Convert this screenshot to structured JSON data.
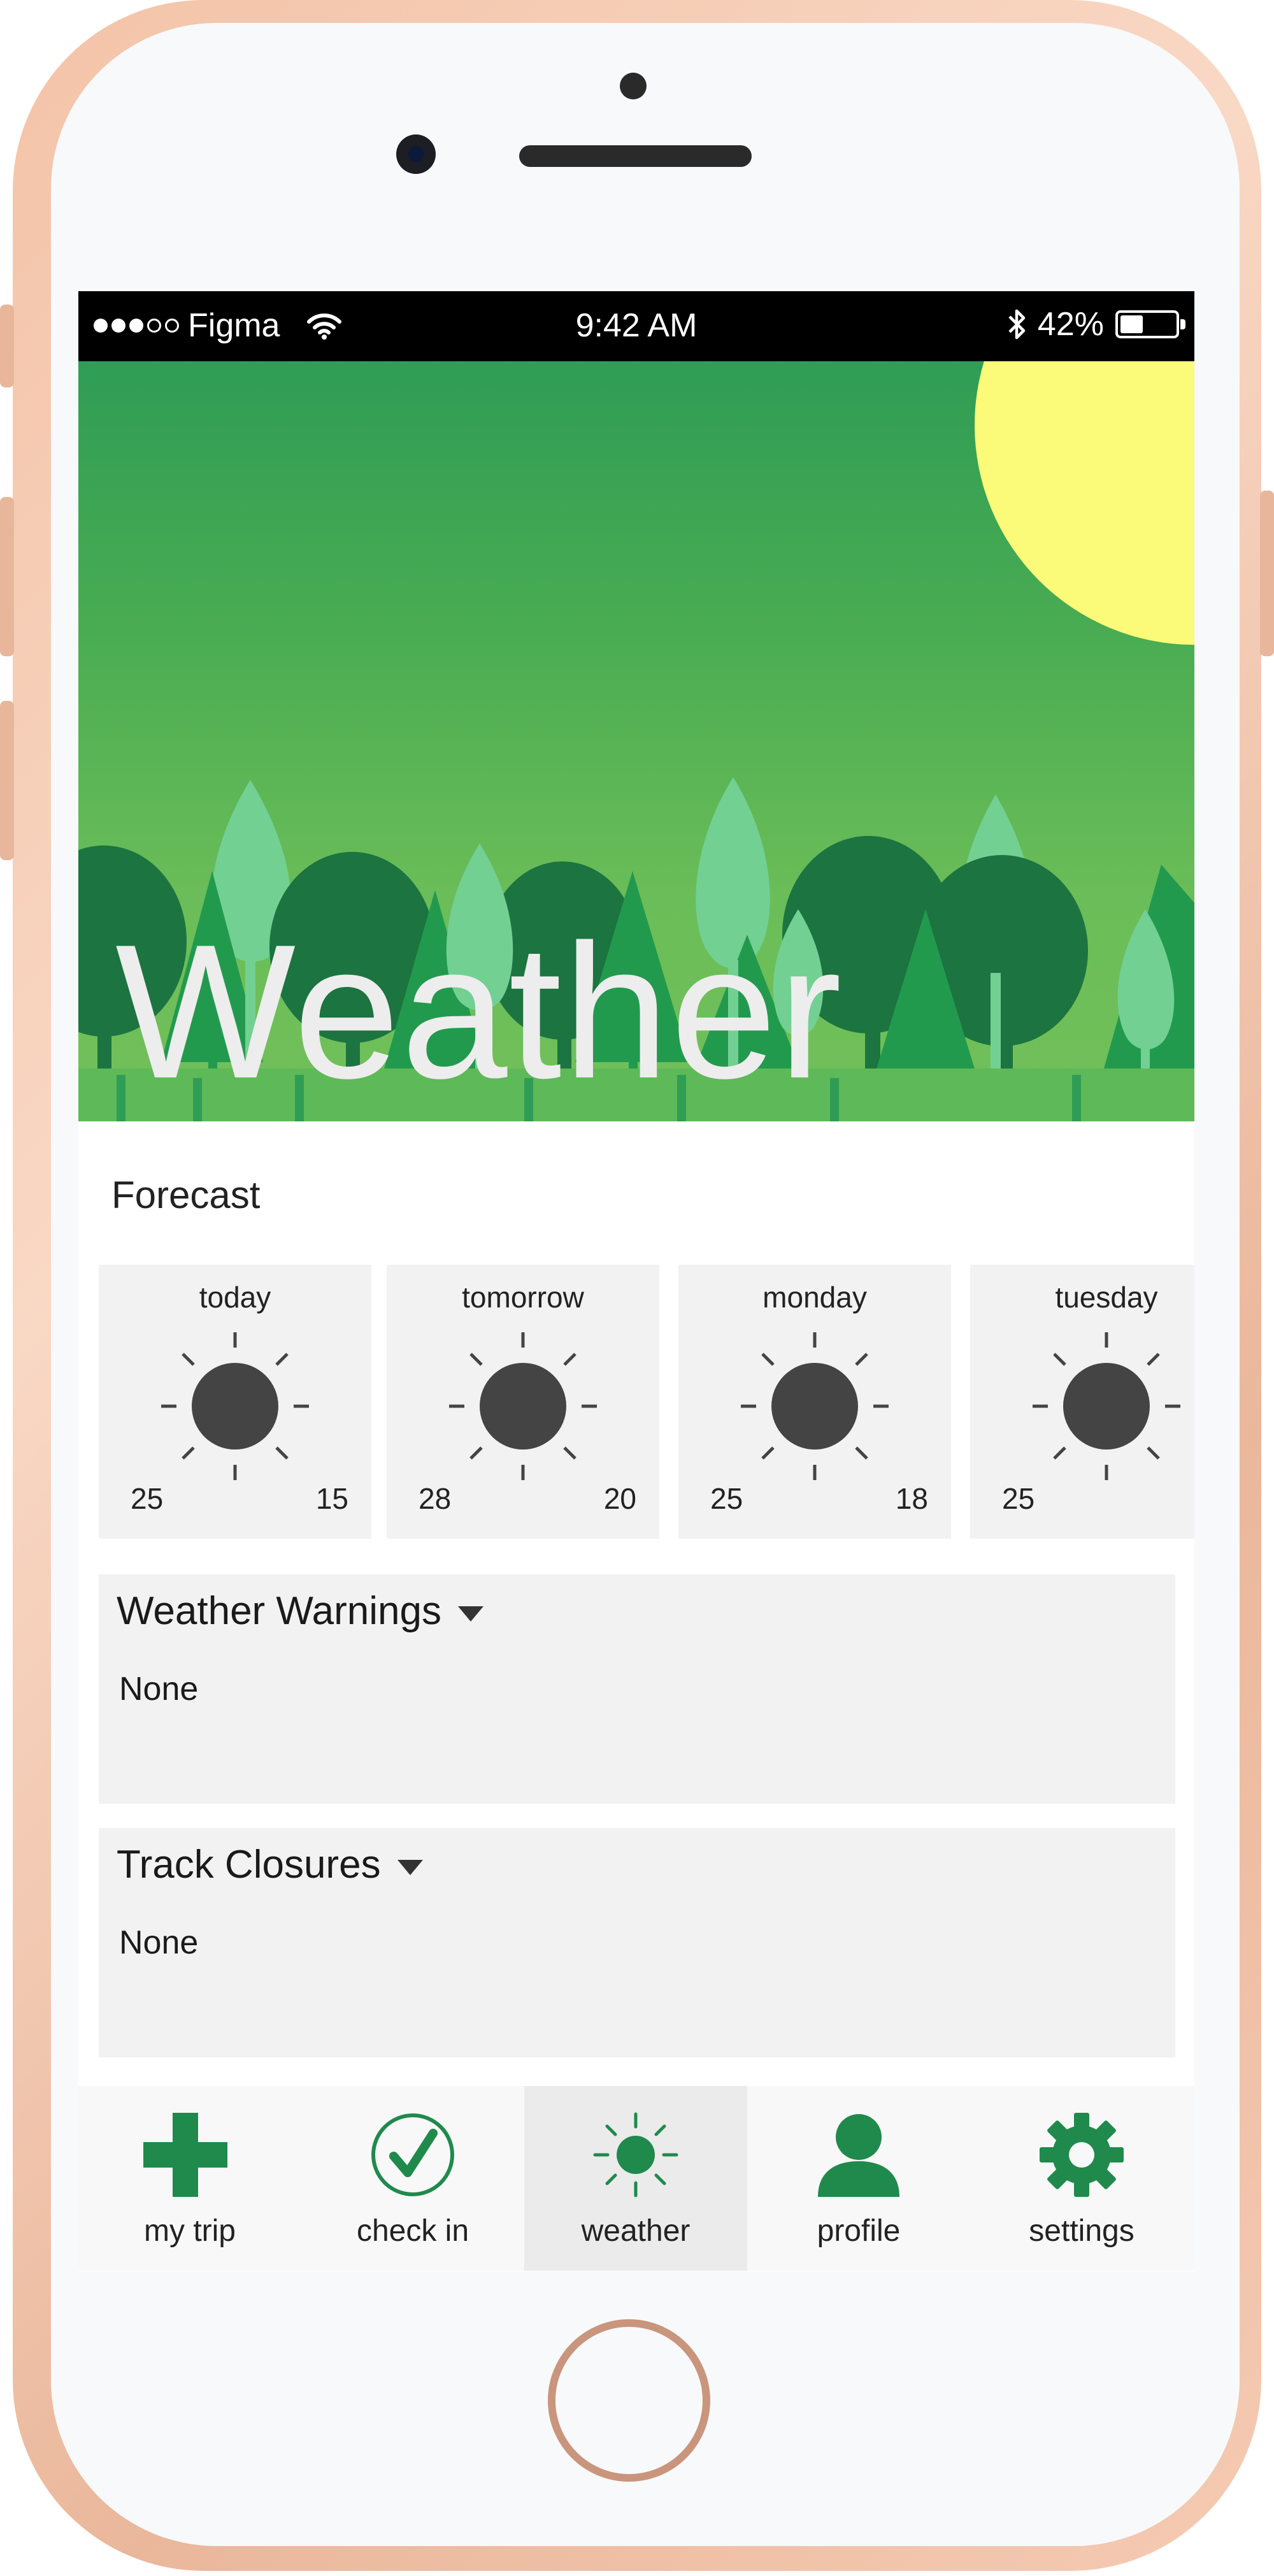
{
  "status_bar": {
    "carrier": "Figma",
    "time": "9:42 AM",
    "battery_text": "42%",
    "battery_level": 0.42,
    "icons": [
      "signal-dots-icon",
      "wifi-icon",
      "bluetooth-icon",
      "battery-icon"
    ]
  },
  "hero": {
    "title": "Weather",
    "colors": {
      "sky_top": "#2f9d55",
      "sky_bottom": "#72c05a",
      "sun": "#fbfb79",
      "tree_dark": "#1c7440",
      "tree_mid": "#229a4e",
      "tree_light": "#72d093"
    }
  },
  "forecast": {
    "title": "Forecast",
    "days": [
      {
        "name": "today",
        "high": "25",
        "low": "15",
        "icon": "sun-icon"
      },
      {
        "name": "tomorrow",
        "high": "28",
        "low": "20",
        "icon": "sun-icon"
      },
      {
        "name": "monday",
        "high": "25",
        "low": "18",
        "icon": "sun-icon"
      },
      {
        "name": "tuesday",
        "high": "25",
        "low": "",
        "icon": "sun-icon"
      }
    ]
  },
  "panels": {
    "warnings": {
      "title": "Weather Warnings",
      "value": "None"
    },
    "closures": {
      "title": "Track Closures",
      "value": "None"
    }
  },
  "tab_bar": {
    "active": "weather",
    "accent": "#1f8a4c",
    "tabs": [
      {
        "id": "my-trip",
        "label": "my trip",
        "icon": "plus-icon"
      },
      {
        "id": "check-in",
        "label": "check in",
        "icon": "checkmark-circle-icon"
      },
      {
        "id": "weather",
        "label": "weather",
        "icon": "sun-icon"
      },
      {
        "id": "profile",
        "label": "profile",
        "icon": "person-icon"
      },
      {
        "id": "settings",
        "label": "settings",
        "icon": "gear-icon"
      }
    ]
  }
}
